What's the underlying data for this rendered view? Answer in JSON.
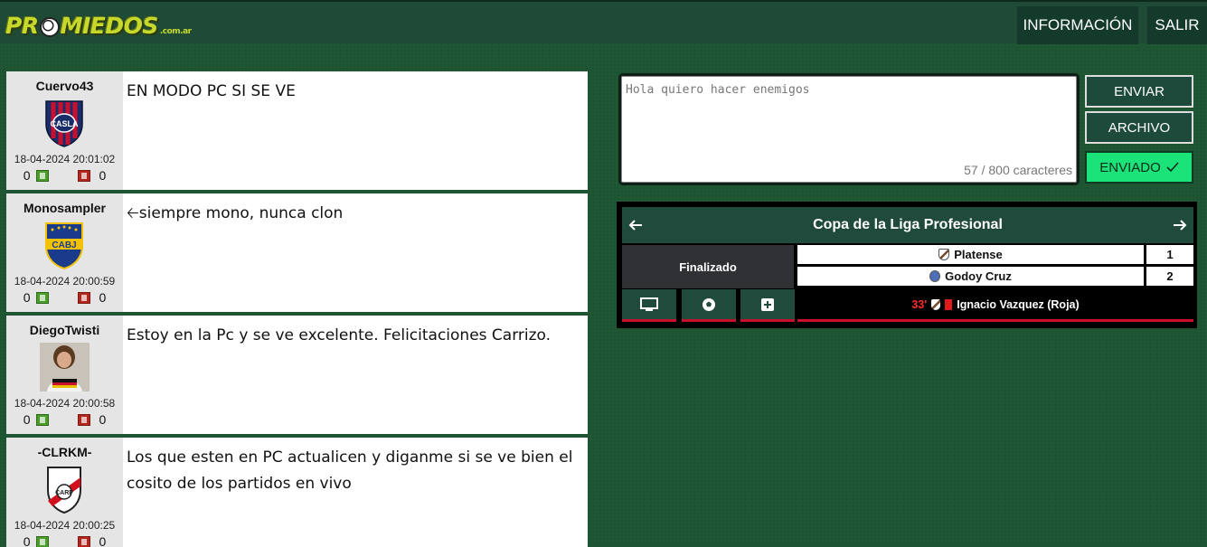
{
  "header": {
    "logo_text": "PR MIEDOS",
    "logo_suffix": ".com.ar",
    "nav": [
      {
        "label": "INFORMACIÓN"
      },
      {
        "label": "SALIR"
      }
    ]
  },
  "posts": [
    {
      "user": "Cuervo43",
      "team": "san-lorenzo",
      "date": "18-04-2024 20:01:02",
      "up": "0",
      "down": "0",
      "text": "EN MODO PC SI SE VE"
    },
    {
      "user": "Monosampler",
      "team": "boca-juniors",
      "date": "18-04-2024 20:00:59",
      "up": "0",
      "down": "0",
      "text": "🡠siempre mono, nunca clon"
    },
    {
      "user": "DiegoTwisti",
      "team": "player-photo",
      "date": "18-04-2024 20:00:58",
      "up": "0",
      "down": "0",
      "text": "Estoy en la Pc y se ve excelente. Felicitaciones Carrizo."
    },
    {
      "user": "-CLRKM-",
      "team": "river-plate",
      "date": "18-04-2024 20:00:25",
      "up": "0",
      "down": "0",
      "text": "Los que esten en PC actualicen y diganme si se ve bien el cosito de los partidos en vivo"
    }
  ],
  "composer": {
    "placeholder": "Hola quiero hacer enemigos",
    "char_count": "57 / 800 caracteres",
    "enviar": "ENVIAR",
    "archivo": "ARCHIVO",
    "enviado": "ENVIADO"
  },
  "scoreboard": {
    "competition": "Copa de la Liga Profesional",
    "status": "Finalizado",
    "teams": [
      {
        "name": "Platense",
        "score": "1"
      },
      {
        "name": "Godoy Cruz",
        "score": "2"
      }
    ],
    "event": {
      "minute": "33'",
      "text": "Ignacio Vazquez (Roja)"
    }
  },
  "colors": {
    "accent_green": "#1be37a",
    "header_bg": "#1f4a36",
    "red_card": "#e01b1b"
  }
}
